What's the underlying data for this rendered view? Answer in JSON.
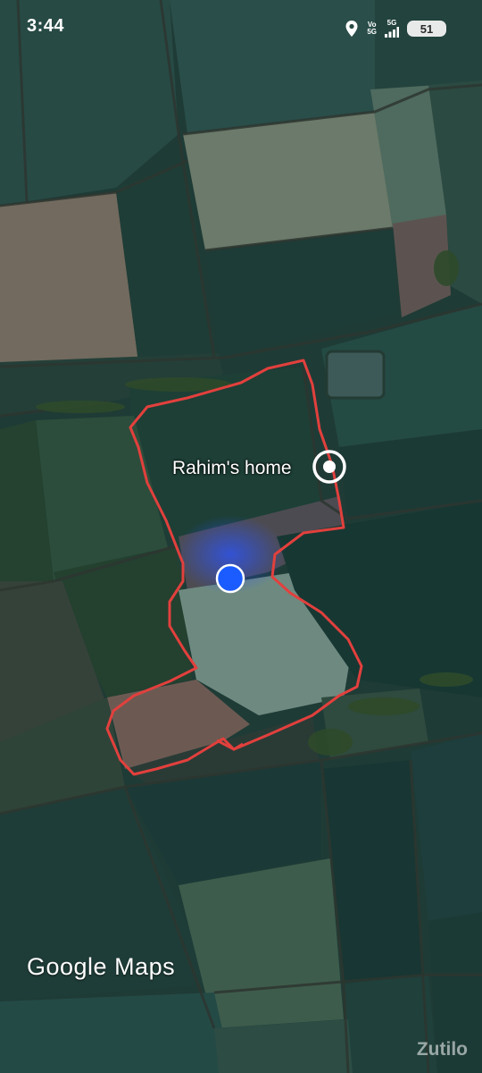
{
  "status_bar": {
    "time": "3:44",
    "network_1": {
      "top": "Vo",
      "bottom": "5G"
    },
    "network_2": "5G",
    "battery": "51",
    "icons": [
      "location-pin-icon",
      "signal-icon"
    ]
  },
  "map": {
    "type": "satellite",
    "place_label": "Rahim's home",
    "route_color": "#e2403d",
    "location_dot_color": "#1a5cff",
    "attribution": "Google Maps"
  },
  "watermark": "Zutilo"
}
